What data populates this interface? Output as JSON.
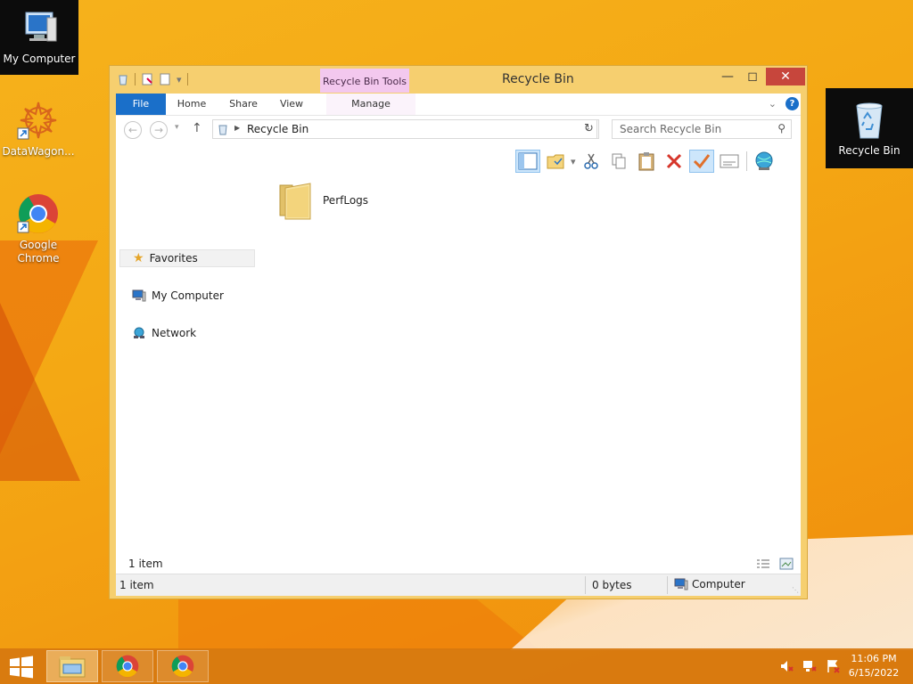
{
  "desktop": {
    "icons": [
      {
        "label": "My Computer"
      },
      {
        "label": "DataWagon..."
      },
      {
        "label": "Google Chrome"
      },
      {
        "label": "Recycle Bin"
      }
    ]
  },
  "window": {
    "title": "Recycle Bin",
    "context_tab": "Recycle Bin Tools",
    "close_glyph": "✕",
    "ribbon_tabs": {
      "file": "File",
      "home": "Home",
      "share": "Share",
      "view": "View",
      "manage": "Manage"
    },
    "address": {
      "breadcrumb": "Recycle Bin",
      "search_placeholder": "Search Recycle Bin"
    },
    "nav_pane": {
      "favorites": "Favorites",
      "my_computer": "My Computer",
      "network": "Network"
    },
    "files": [
      {
        "name": "PerfLogs",
        "icon": "folder-icon"
      }
    ],
    "item_count": "1 item",
    "status": {
      "items": "1 item",
      "size": "0 bytes",
      "location": "Computer"
    }
  },
  "taskbar": {
    "time": "11:06 PM",
    "date": "6/15/2022"
  },
  "colors": {
    "accent": "#1a6fc9",
    "window_frame": "#f6cf6f",
    "close": "#c7463c",
    "context_tab": "#f3c8ee"
  }
}
